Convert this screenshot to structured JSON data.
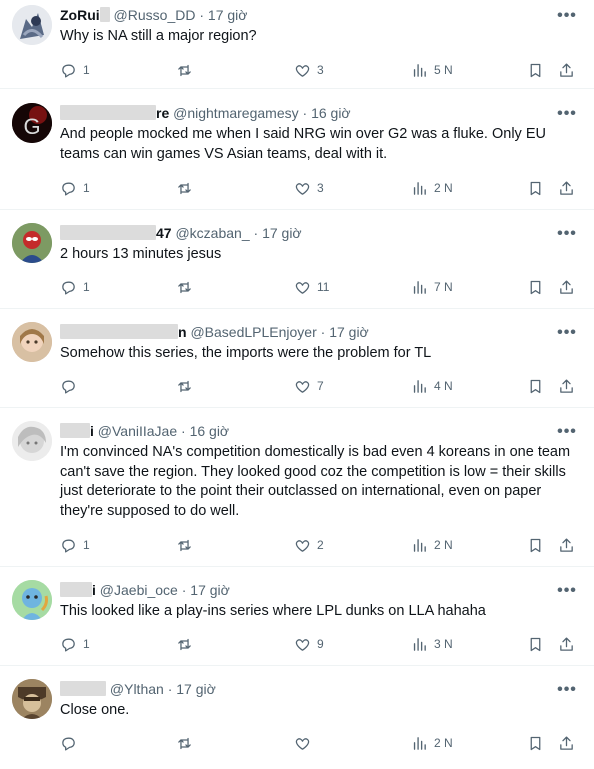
{
  "tweets": [
    {
      "name_visible": "ZoRui",
      "handle": "@Russo_DD",
      "time": "17 giờ",
      "text": "Why is NA still a major region?",
      "replies": "1",
      "reposts": "",
      "likes": "3",
      "views": "5 N"
    },
    {
      "name_visible": "re",
      "handle": "@nightmaregamesy",
      "time": "16 giờ",
      "text": "And people mocked me when I said NRG win over G2 was a fluke. Only EU teams can win games VS Asian teams, deal with it.",
      "replies": "1",
      "reposts": "",
      "likes": "3",
      "views": "2 N"
    },
    {
      "name_visible": "47",
      "handle": "@kczaban_",
      "time": "17 giờ",
      "text": "2 hours 13 minutes jesus",
      "replies": "1",
      "reposts": "",
      "likes": "11",
      "views": "7 N"
    },
    {
      "name_visible": "n",
      "handle": "@BasedLPLEnjoyer",
      "time": "17 giờ",
      "text": "Somehow this series, the imports were the problem for TL",
      "replies": "",
      "reposts": "",
      "likes": "7",
      "views": "4 N"
    },
    {
      "name_visible": "i",
      "handle": "@VaniIIaJae",
      "time": "16 giờ",
      "text": "I'm convinced NA's competition domestically is bad even 4 koreans in one team can't save the region. They looked good coz the competition is low = their skills just deteriorate to the point their outclassed on international, even on paper they're supposed to do well.",
      "replies": "1",
      "reposts": "",
      "likes": "2",
      "views": "2 N"
    },
    {
      "name_visible": "i",
      "handle": "@Jaebi_oce",
      "time": "17 giờ",
      "text": "This looked like a play-ins series where LPL dunks on LLA hahaha",
      "replies": "1",
      "reposts": "",
      "likes": "9",
      "views": "3 N"
    },
    {
      "name_visible": "",
      "handle": "@Ylthan",
      "time": "17 giờ",
      "text": "Close one.",
      "replies": "",
      "reposts": "",
      "likes": "",
      "views": "2 N"
    }
  ],
  "icons": {
    "reply": "reply-icon",
    "repost": "repost-icon",
    "like": "heart-icon",
    "views": "views-icon",
    "bookmark": "bookmark-icon",
    "share": "share-icon",
    "more": "more-icon"
  },
  "dot": "·",
  "more_glyph": "•••",
  "colors": {
    "text": "#0f1419",
    "secondary": "#536471",
    "divider": "#eff3f4",
    "redaction": "#dcdcdc"
  }
}
